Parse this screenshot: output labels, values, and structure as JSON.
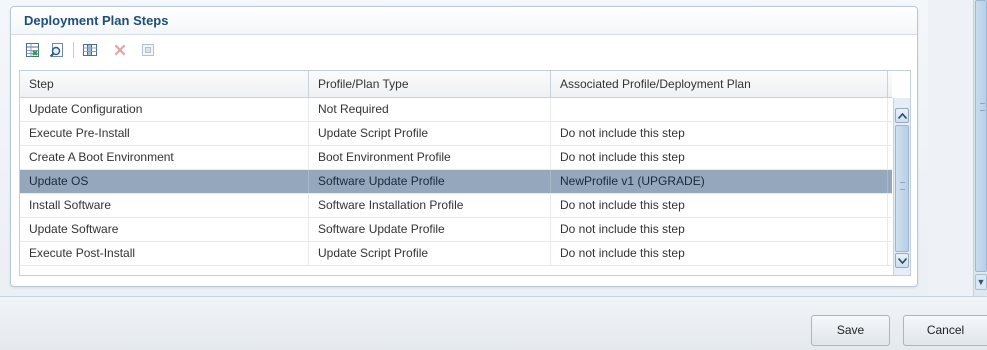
{
  "panel": {
    "title": "Deployment Plan Steps"
  },
  "toolbar": {
    "buttons": [
      {
        "icon": "export-spreadsheet-icon"
      },
      {
        "icon": "find-icon"
      },
      {
        "icon": "columns-icon"
      },
      {
        "icon": "delete-icon"
      },
      {
        "icon": "detach-icon"
      }
    ]
  },
  "table": {
    "columns": [
      "Step",
      "Profile/Plan Type",
      "Associated Profile/Deployment Plan"
    ],
    "rows": [
      {
        "step": "Update Configuration",
        "type": "Not Required",
        "assoc": ""
      },
      {
        "step": "Execute Pre-Install",
        "type": "Update Script Profile",
        "assoc": "Do not include this step"
      },
      {
        "step": "Create A Boot Environment",
        "type": "Boot Environment Profile",
        "assoc": "Do not include this step"
      },
      {
        "step": "Update OS",
        "type": "Software Update Profile",
        "assoc": "NewProfile v1 (UPGRADE)"
      },
      {
        "step": "Install Software",
        "type": "Software Installation Profile",
        "assoc": "Do not include this step"
      },
      {
        "step": "Update Software",
        "type": "Software Update Profile",
        "assoc": "Do not include this step"
      },
      {
        "step": "Execute Post-Install",
        "type": "Update Script Profile",
        "assoc": "Do not include this step"
      }
    ],
    "selected_index": 3
  },
  "footer": {
    "save_label": "Save",
    "cancel_label": "Cancel"
  },
  "colors": {
    "title": "#1f4e79",
    "selected_row": "#94a7bd"
  }
}
